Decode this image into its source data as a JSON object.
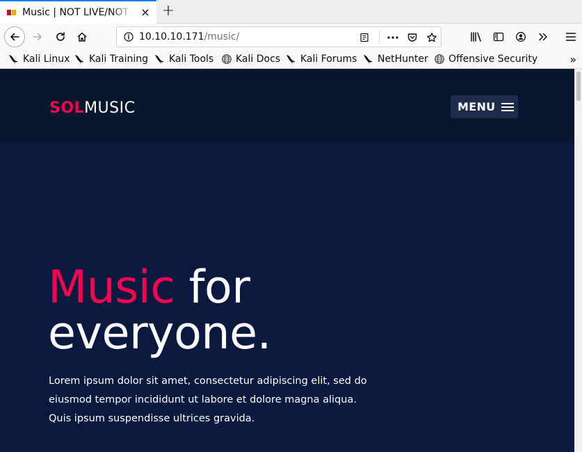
{
  "browser": {
    "tab": {
      "title": "Music | NOT LIVE/NOT FOR PRODUCTION",
      "close_glyph": "×"
    },
    "new_tab_glyph": "+",
    "url": {
      "host": "10.10.10.171",
      "path": "/music/"
    },
    "bookmarks": [
      {
        "label": "Kali Linux",
        "icon": "kali-dragon-icon"
      },
      {
        "label": "Kali Training",
        "icon": "kali-dragon-icon"
      },
      {
        "label": "Kali Tools",
        "icon": "kali-dragon-icon"
      },
      {
        "label": "Kali Docs",
        "icon": "globe-icon"
      },
      {
        "label": "Kali Forums",
        "icon": "kali-dragon-icon"
      },
      {
        "label": "NetHunter",
        "icon": "kali-dragon-icon"
      },
      {
        "label": "Offensive Security",
        "icon": "globe-icon"
      }
    ],
    "overflow_glyph": "»"
  },
  "site": {
    "logo": {
      "accent": "SOL",
      "rest": "MUSIC"
    },
    "menu_label": "MENU",
    "hero": {
      "title_accent": "Music",
      "title_rest1": " for",
      "title_rest2": "everyone.",
      "text": "Lorem ipsum dolor sit amet, consectetur adipiscing elit, sed do eiusmod tempor incididunt ut labore et dolore magna aliqua. Quis ipsum suspendisse ultrices gravida."
    }
  },
  "colors": {
    "accent": "#f3054f",
    "header_bg": "#08162e",
    "hero_bg": "#0b1840",
    "menu_bg": "#1d2b4d"
  }
}
